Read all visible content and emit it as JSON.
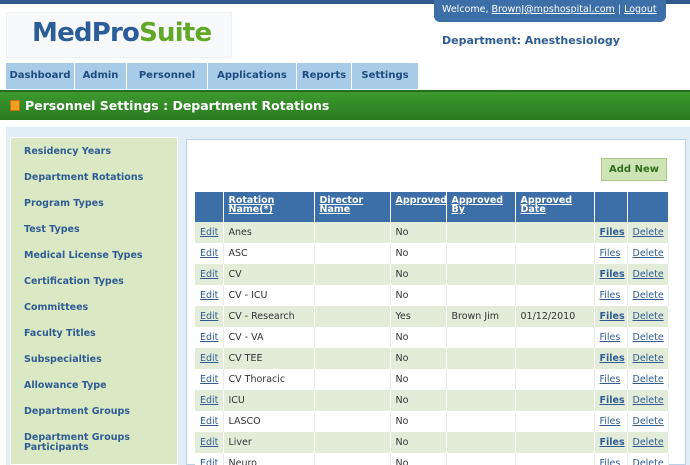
{
  "logo": {
    "part1": "MedPro",
    "part2": "Suite"
  },
  "header": {
    "welcome_prefix": "Welcome, ",
    "user_email": "BrownJ@mpshospital.com",
    "separator": "|",
    "logout": "Logout",
    "department": "Department: Anesthesiology"
  },
  "nav": {
    "tabs": [
      "Dashboard",
      "Admin",
      "Personnel",
      "Applications",
      "Reports",
      "Settings"
    ]
  },
  "page_title": "Personnel Settings : Department Rotations",
  "sidebar": {
    "items": [
      "Residency Years",
      "Department Rotations",
      "Program Types",
      "Test Types",
      "Medical License Types",
      "Certification Types",
      "Committees",
      "Faculty Titles",
      "Subspecialties",
      "Allowance Type",
      "Department Groups",
      "Department Groups Participants"
    ]
  },
  "add_new_label": "Add New",
  "table": {
    "headers": [
      "",
      "Rotation Name(*)",
      "Director Name",
      "Approved",
      "Approved By",
      "Approved Date",
      "",
      ""
    ],
    "edit_label": "Edit",
    "files_label": "Files",
    "delete_label": "Delete",
    "rows": [
      {
        "name": "Anes",
        "director": "",
        "approved": "No",
        "approved_by": "",
        "approved_date": ""
      },
      {
        "name": "ASC",
        "director": "",
        "approved": "No",
        "approved_by": "",
        "approved_date": ""
      },
      {
        "name": "CV",
        "director": "",
        "approved": "No",
        "approved_by": "",
        "approved_date": ""
      },
      {
        "name": "CV - ICU",
        "director": "",
        "approved": "No",
        "approved_by": "",
        "approved_date": ""
      },
      {
        "name": "CV - Research",
        "director": "",
        "approved": "Yes",
        "approved_by": "Brown Jim",
        "approved_date": "01/12/2010"
      },
      {
        "name": "CV - VA",
        "director": "",
        "approved": "No",
        "approved_by": "",
        "approved_date": ""
      },
      {
        "name": "CV TEE",
        "director": "",
        "approved": "No",
        "approved_by": "",
        "approved_date": ""
      },
      {
        "name": "CV Thoracic",
        "director": "",
        "approved": "No",
        "approved_by": "",
        "approved_date": ""
      },
      {
        "name": "ICU",
        "director": "",
        "approved": "No",
        "approved_by": "",
        "approved_date": ""
      },
      {
        "name": "LASCO",
        "director": "",
        "approved": "No",
        "approved_by": "",
        "approved_date": ""
      },
      {
        "name": "Liver",
        "director": "",
        "approved": "No",
        "approved_by": "",
        "approved_date": ""
      },
      {
        "name": "Neuro",
        "director": "",
        "approved": "No",
        "approved_by": "",
        "approved_date": ""
      }
    ]
  }
}
